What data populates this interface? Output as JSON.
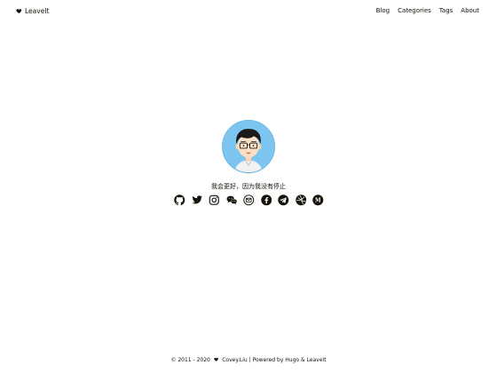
{
  "header": {
    "brand": "LeaveIt",
    "nav": [
      "Blog",
      "Categories",
      "Tags",
      "About"
    ]
  },
  "profile": {
    "subtitle": "我会更好，因为我没有停止"
  },
  "social_icons": [
    "github-icon",
    "twitter-icon",
    "instagram-icon",
    "wechat-icon",
    "email-icon",
    "facebook-icon",
    "telegram-icon",
    "dribbble-icon",
    "medium-icon"
  ],
  "footer": {
    "years": "© 2011 - 2020",
    "author": "Covey.Liu",
    "powered": "| Powered by Hugo & LeaveIt"
  },
  "colors": {
    "text": "#161209",
    "avatar_bg": "#7cc5f0",
    "background": "#ffffff"
  }
}
